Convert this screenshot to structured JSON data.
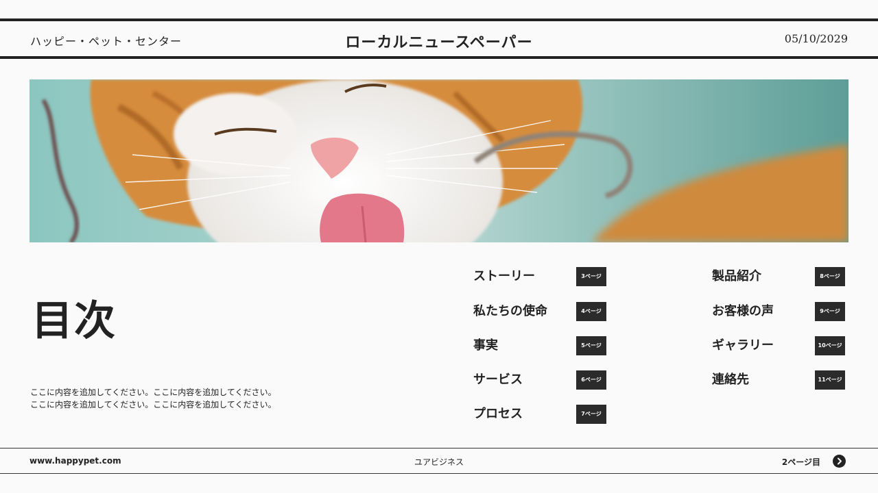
{
  "header": {
    "brand": "ハッピー・ペット・センター",
    "title": "ローカルニュースペーパー",
    "date": "05/10/2029"
  },
  "hero": {
    "image_subject": "cat-licking-photo"
  },
  "toc": {
    "heading": "目次",
    "description_lines": [
      "ここに内容を追加してください。ここに内容を追加してください。",
      "ここに内容を追加してください。ここに内容を追加してください。"
    ],
    "left_column": [
      {
        "label": "ストーリー",
        "page": "3ページ"
      },
      {
        "label": "私たちの使命",
        "page": "4ページ"
      },
      {
        "label": "事実",
        "page": "5ページ"
      },
      {
        "label": "サービス",
        "page": "6ページ"
      },
      {
        "label": "プロセス",
        "page": "7ページ"
      }
    ],
    "right_column": [
      {
        "label": "製品紹介",
        "page": "8ページ"
      },
      {
        "label": "お客様の声",
        "page": "9ページ"
      },
      {
        "label": "ギャラリー",
        "page": "10ページ"
      },
      {
        "label": "連絡先",
        "page": "11ページ"
      }
    ]
  },
  "footer": {
    "website": "www.happypet.com",
    "company": "ユアビジネス",
    "page_label": "2ページ目",
    "next_icon": "chevron-right-icon"
  },
  "colors": {
    "background": "#fbfafb",
    "ink": "#222222",
    "badge": "#2b2b2b",
    "hero_teal": "#7ab7ad",
    "cat_orange": "#d98e3f"
  }
}
